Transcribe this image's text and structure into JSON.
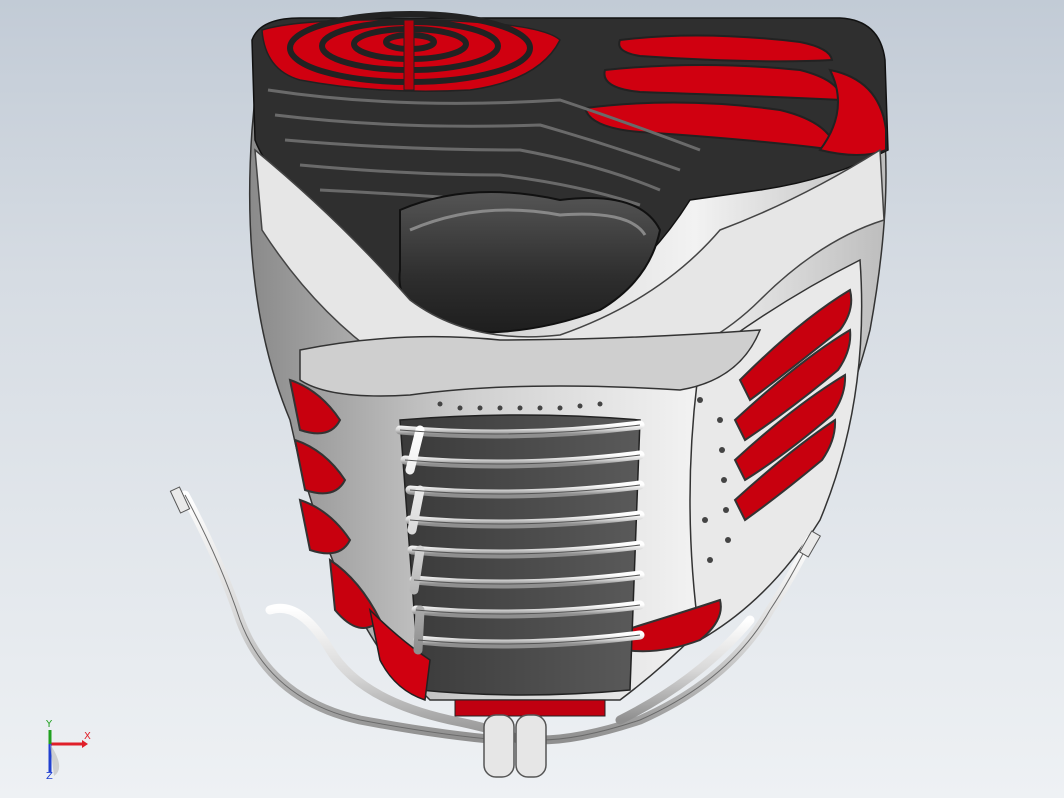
{
  "viewport": {
    "background_top": "#c2cbd6",
    "background_bottom": "#eef1f4",
    "model": {
      "name": "shoe-model",
      "colors": {
        "red": "#d00010",
        "dark_red": "#8c0008",
        "black": "#2b2b2b",
        "dark_grey": "#4a4a4a",
        "grey": "#9a9a9a",
        "light_grey": "#d8d8d8",
        "white": "#f4f4f4"
      }
    }
  },
  "triad": {
    "x_label": "X",
    "y_label": "Y",
    "z_label": "Z",
    "x_color": "#e0202a",
    "y_color": "#20a020",
    "z_color": "#2040d0"
  }
}
